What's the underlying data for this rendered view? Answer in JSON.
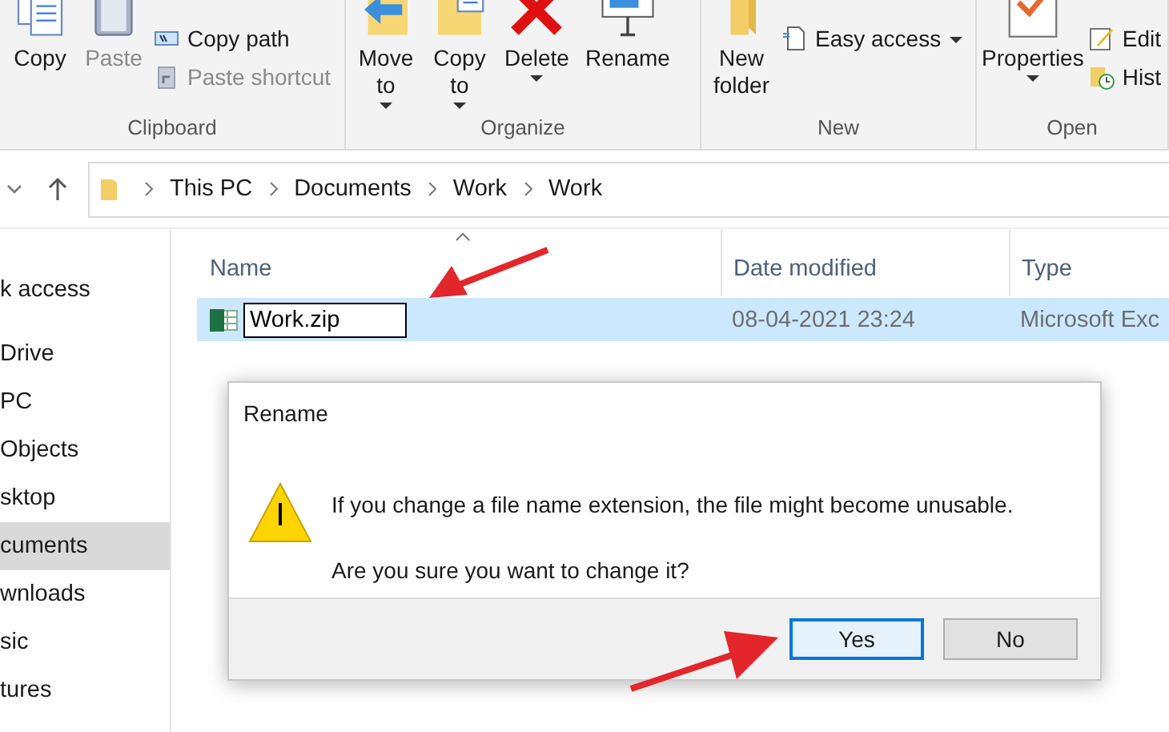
{
  "ribbon": {
    "groups": [
      {
        "label": "Clipboard",
        "large": [
          {
            "label": "Copy",
            "dropdown": false,
            "disabled": false
          },
          {
            "label": "Paste",
            "dropdown": false,
            "disabled": true
          }
        ],
        "small": [
          {
            "label": "Copy path",
            "dropdown": false,
            "disabled": false
          },
          {
            "label": "Paste shortcut",
            "dropdown": false,
            "disabled": true
          }
        ]
      },
      {
        "label": "Organize",
        "large": [
          {
            "label": "Move to",
            "dropdown": true,
            "disabled": false
          },
          {
            "label": "Copy to",
            "dropdown": true,
            "disabled": false
          },
          {
            "label": "Delete",
            "dropdown": true,
            "disabled": false
          },
          {
            "label": "Rename",
            "dropdown": false,
            "disabled": false
          }
        ]
      },
      {
        "label": "New",
        "large": [
          {
            "label": "New folder",
            "dropdown": false,
            "disabled": false
          }
        ],
        "small": [
          {
            "label": "Easy access",
            "dropdown": true,
            "disabled": false
          }
        ]
      },
      {
        "label": "Open",
        "large": [
          {
            "label": "Properties",
            "dropdown": true,
            "disabled": false
          }
        ],
        "small": [
          {
            "label": "Edit",
            "dropdown": false,
            "disabled": false
          },
          {
            "label": "Hist",
            "dropdown": false,
            "disabled": false
          }
        ]
      }
    ]
  },
  "address_bar": {
    "breadcrumbs": [
      "This PC",
      "Documents",
      "Work",
      "Work"
    ]
  },
  "navigation": [
    {
      "label": "k access",
      "selected": false
    },
    {
      "label": "Drive",
      "selected": false
    },
    {
      "label": "PC",
      "selected": false
    },
    {
      "label": "Objects",
      "selected": false
    },
    {
      "label": "sktop",
      "selected": false
    },
    {
      "label": "cuments",
      "selected": true
    },
    {
      "label": "wnloads",
      "selected": false
    },
    {
      "label": "sic",
      "selected": false
    },
    {
      "label": "tures",
      "selected": false
    }
  ],
  "file_list": {
    "columns": [
      {
        "label": "Name",
        "sorted": true
      },
      {
        "label": "Date modified",
        "sorted": false
      },
      {
        "label": "Type",
        "sorted": false
      }
    ],
    "rows": [
      {
        "name": "Work.zip",
        "date": "08-04-2021 23:24",
        "type": "Microsoft Exc",
        "selected": true,
        "editing": true
      }
    ]
  },
  "dialog": {
    "title": "Rename",
    "message": "If you change a file name extension, the file might become unusable.",
    "question": "Are you sure you want to change it?",
    "buttons": [
      {
        "label": "Yes",
        "default": true
      },
      {
        "label": "No",
        "default": false
      }
    ]
  }
}
